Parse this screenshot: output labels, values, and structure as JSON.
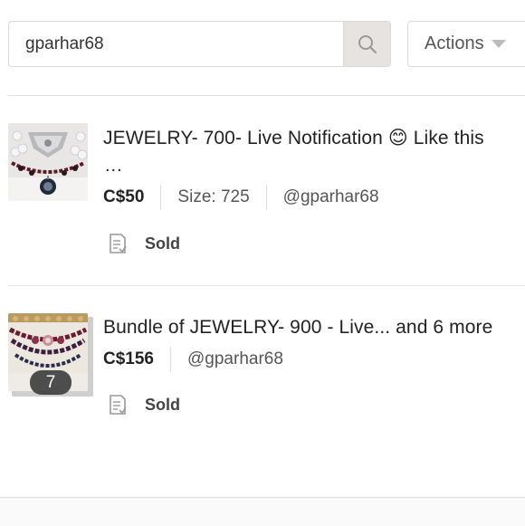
{
  "search": {
    "value": "gparhar68",
    "placeholder": ""
  },
  "actions": {
    "label": "Actions"
  },
  "listings": [
    {
      "title": "JEWELRY- 700- Live Notification 😊 Like this",
      "title_continuation": "...",
      "price": "C$50",
      "size": "Size: 725",
      "seller": "@gparhar68",
      "status": "Sold",
      "thumbnail_icon": "jewelry-necklace-photo"
    },
    {
      "title": "Bundle of JEWELRY- 900 - Live... and 6 more",
      "price": "C$156",
      "seller": "@gparhar68",
      "status": "Sold",
      "item_count": "7",
      "thumbnail_icon": "jewelry-bundle-photo"
    }
  ],
  "colors": {
    "search_button_bg": "#e6e3e1",
    "border": "#d9d9d9",
    "text": "#222222",
    "muted_text": "#555555"
  }
}
